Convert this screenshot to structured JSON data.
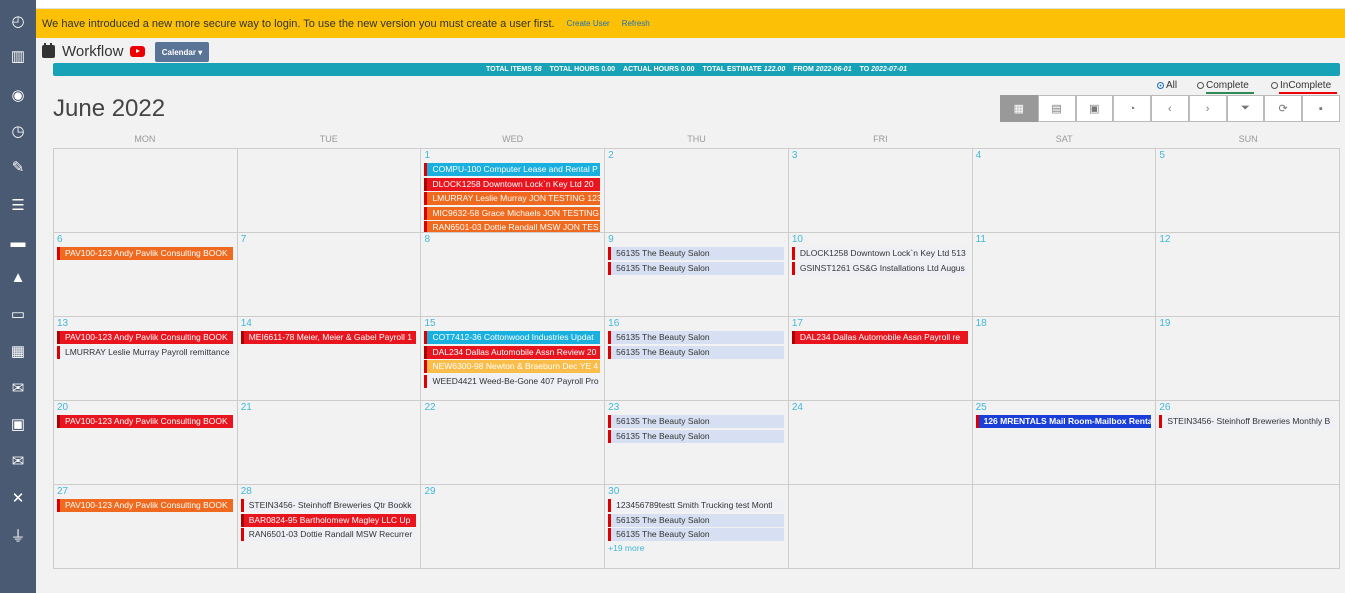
{
  "banner": {
    "message": "We have introduced a new more secure way to login. To use the new version you must create a user first.",
    "create_user": "Create User",
    "refresh": "Refresh"
  },
  "header": {
    "title": "Workflow",
    "calendar_button": "Calendar ▾"
  },
  "totals": {
    "items_label": "TOTAL ITEMS",
    "items": "58",
    "hours_label": "TOTAL HOURS",
    "hours": "0.00",
    "actual_label": "ACTUAL HOURS",
    "actual": "0.00",
    "estimate_label": "TOTAL ESTIMATE",
    "estimate": "122.00",
    "from_label": "FROM",
    "from": "2022-06-01",
    "to_label": "TO",
    "to": "2022-07-01"
  },
  "filters": {
    "all": "All",
    "complete": "Complete",
    "incomplete": "InComplete",
    "selected": "All"
  },
  "month_title": "June 2022",
  "toolbar_icons": [
    "calendar-month-icon",
    "calendar-week-icon",
    "calendar-day-icon",
    "clock-icon",
    "chevron-left-icon",
    "chevron-right-icon",
    "filter-icon",
    "refresh-icon",
    "save-icon"
  ],
  "toolbar_glyphs": [
    "▦",
    "▤",
    "▣",
    "◔",
    "‹",
    "›",
    "⏷",
    "⟳",
    "▪"
  ],
  "sidebar_icons": [
    "dashboard-icon",
    "chart-icon",
    "users-icon",
    "clock-icon",
    "wrench-icon",
    "list-icon",
    "briefcase-icon",
    "mountain-icon",
    "money-icon",
    "calendar-icon",
    "envelope-icon",
    "contact-icon",
    "mail-stack-icon",
    "tools-icon",
    "plug-icon"
  ],
  "sidebar_glyphs": [
    "◴",
    "▥",
    "◉",
    "◷",
    "✎",
    "☰",
    "▬",
    "▲",
    "▭",
    "▦",
    "✉",
    "▣",
    "✉",
    "✕",
    "⏚"
  ],
  "days_of_week": [
    "MON",
    "TUE",
    "WED",
    "THU",
    "FRI",
    "SAT",
    "SUN"
  ],
  "weeks": [
    [
      {
        "num": "",
        "events": []
      },
      {
        "num": "",
        "events": []
      },
      {
        "num": "1",
        "events": [
          {
            "text": "COMPU-100 Computer Lease and Rental P",
            "color": "cyan"
          },
          {
            "text": "DLOCK1258 Downtown Lock`n Key Ltd 20",
            "color": "red"
          },
          {
            "text": "LMURRAY Leslie Murray JON TESTING 123",
            "color": "orange"
          },
          {
            "text": "MIC9632-58 Grace Michaels JON TESTING",
            "color": "orange"
          },
          {
            "text": "RAN6501-03 Dottie Randall MSW JON TES",
            "color": "orange"
          }
        ]
      },
      {
        "num": "2",
        "events": []
      },
      {
        "num": "3",
        "events": []
      },
      {
        "num": "4",
        "events": []
      },
      {
        "num": "5",
        "events": []
      }
    ],
    [
      {
        "num": "6",
        "events": [
          {
            "text": "PAV100-123 Andy Pavlik Consulting BOOK",
            "color": "orange"
          }
        ]
      },
      {
        "num": "7",
        "events": []
      },
      {
        "num": "8",
        "events": []
      },
      {
        "num": "9",
        "events": [
          {
            "text": "56135 The Beauty Salon",
            "color": "light"
          },
          {
            "text": "56135 The Beauty Salon",
            "color": "light"
          }
        ]
      },
      {
        "num": "10",
        "events": [
          {
            "text": "DLOCK1258 Downtown Lock`n Key Ltd 513",
            "color": "white"
          },
          {
            "text": "GSINST1261 GS&G Installations Ltd Augus",
            "color": "white"
          }
        ]
      },
      {
        "num": "11",
        "events": []
      },
      {
        "num": "12",
        "events": []
      }
    ],
    [
      {
        "num": "13",
        "events": [
          {
            "text": "PAV100-123 Andy Pavlik Consulting BOOK",
            "color": "red"
          },
          {
            "text": "LMURRAY Leslie Murray Payroll remittance",
            "color": "white"
          }
        ]
      },
      {
        "num": "14",
        "events": [
          {
            "text": "MEI6611-78 Meier, Meier & Gabel Payroll 1",
            "color": "red"
          }
        ]
      },
      {
        "num": "15",
        "events": [
          {
            "text": "COT7412-36 Cottonwood Industries Updat",
            "color": "cyan"
          },
          {
            "text": "DAL234 Dallas Automobile Assn Review 20",
            "color": "red"
          },
          {
            "text": "NEW6300-98 Newton & Braeburn Dec YE 4",
            "color": "yellow"
          },
          {
            "text": "WEED4421 Weed-Be-Gone 407 Payroll Pro",
            "color": "white"
          }
        ]
      },
      {
        "num": "16",
        "events": [
          {
            "text": "56135 The Beauty Salon",
            "color": "light"
          },
          {
            "text": "56135 The Beauty Salon",
            "color": "light"
          }
        ]
      },
      {
        "num": "17",
        "events": [
          {
            "text": "DAL234 Dallas Automobile Assn Payroll re",
            "color": "red"
          }
        ]
      },
      {
        "num": "18",
        "events": []
      },
      {
        "num": "19",
        "events": []
      }
    ],
    [
      {
        "num": "20",
        "events": [
          {
            "text": "PAV100-123 Andy Pavlik Consulting BOOK",
            "color": "red"
          }
        ]
      },
      {
        "num": "21",
        "events": []
      },
      {
        "num": "22",
        "events": []
      },
      {
        "num": "23",
        "events": [
          {
            "text": "56135 The Beauty Salon",
            "color": "light"
          },
          {
            "text": "56135 The Beauty Salon",
            "color": "light"
          }
        ]
      },
      {
        "num": "24",
        "events": []
      },
      {
        "num": "25",
        "events": [
          {
            "text": "126 MRENTALS Mail Room-Mailbox Renta",
            "color": "blue"
          }
        ]
      },
      {
        "num": "26",
        "events": [
          {
            "text": "STEIN3456- Steinhoff Breweries Monthly B",
            "color": "white"
          }
        ]
      }
    ],
    [
      {
        "num": "27",
        "events": [
          {
            "text": "PAV100-123 Andy Pavlik Consulting BOOK",
            "color": "orange"
          }
        ]
      },
      {
        "num": "28",
        "events": [
          {
            "text": "STEIN3456- Steinhoff Breweries Qtr Bookk",
            "color": "white"
          },
          {
            "text": "BAR0824-95 Bartholomew Magley LLC Up",
            "color": "red"
          },
          {
            "text": "RAN6501-03 Dottie Randall MSW Recurrer",
            "color": "white"
          }
        ]
      },
      {
        "num": "29",
        "events": []
      },
      {
        "num": "30",
        "events": [
          {
            "text": "123456789testt Smith Trucking test Montl",
            "color": "white"
          },
          {
            "text": "56135 The Beauty Salon",
            "color": "light"
          },
          {
            "text": "56135 The Beauty Salon",
            "color": "light"
          }
        ],
        "more": "+19 more"
      },
      {
        "num": "",
        "events": []
      },
      {
        "num": "",
        "events": []
      },
      {
        "num": "",
        "events": []
      }
    ]
  ]
}
